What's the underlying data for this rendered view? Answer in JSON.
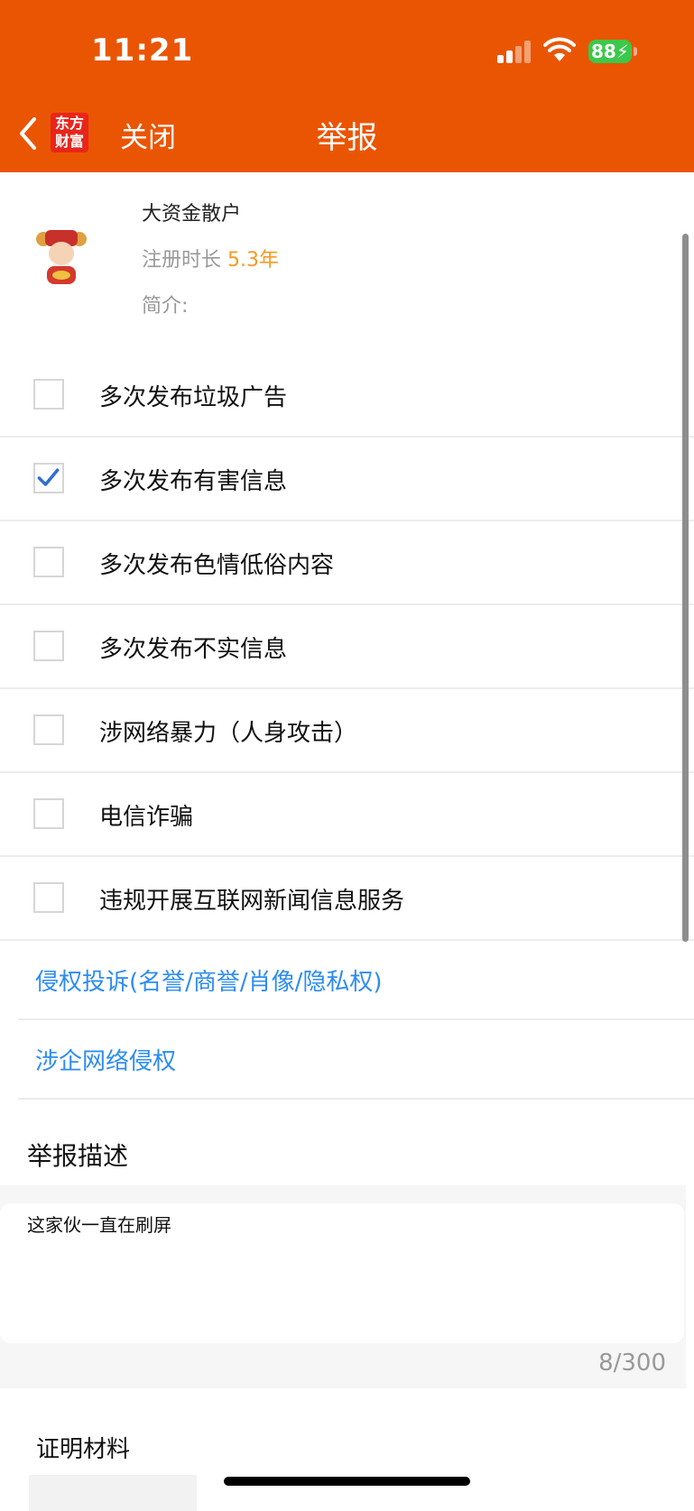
{
  "status_bar": {
    "time": "11:21",
    "battery": "88"
  },
  "nav": {
    "logo_line1": "东方",
    "logo_line2": "财富",
    "close_label": "关闭",
    "title": "举报"
  },
  "user": {
    "name": "大资金散户",
    "reg_label": "注册时长",
    "reg_value": "5.3年",
    "intro_label": "简介:"
  },
  "reasons": [
    {
      "label": "多次发布垃圾广告",
      "checked": false
    },
    {
      "label": "多次发布有害信息",
      "checked": true
    },
    {
      "label": "多次发布色情低俗内容",
      "checked": false
    },
    {
      "label": "多次发布不实信息",
      "checked": false
    },
    {
      "label": "涉网络暴力（人身攻击）",
      "checked": false
    },
    {
      "label": "电信诈骗",
      "checked": false
    },
    {
      "label": "违规开展互联网新闻信息服务",
      "checked": false
    }
  ],
  "links": [
    {
      "label": "侵权投诉(名誉/商誉/肖像/隐私权)"
    },
    {
      "label": "涉企网络侵权"
    }
  ],
  "description": {
    "title": "举报描述",
    "value": "这家伙一直在刷屏",
    "counter": "8/300"
  },
  "proof": {
    "title": "证明材料"
  },
  "colors": {
    "brand": "#EA5504",
    "link": "#2D8CF0",
    "highlight": "#F59A23",
    "check": "#2F6FD0"
  }
}
